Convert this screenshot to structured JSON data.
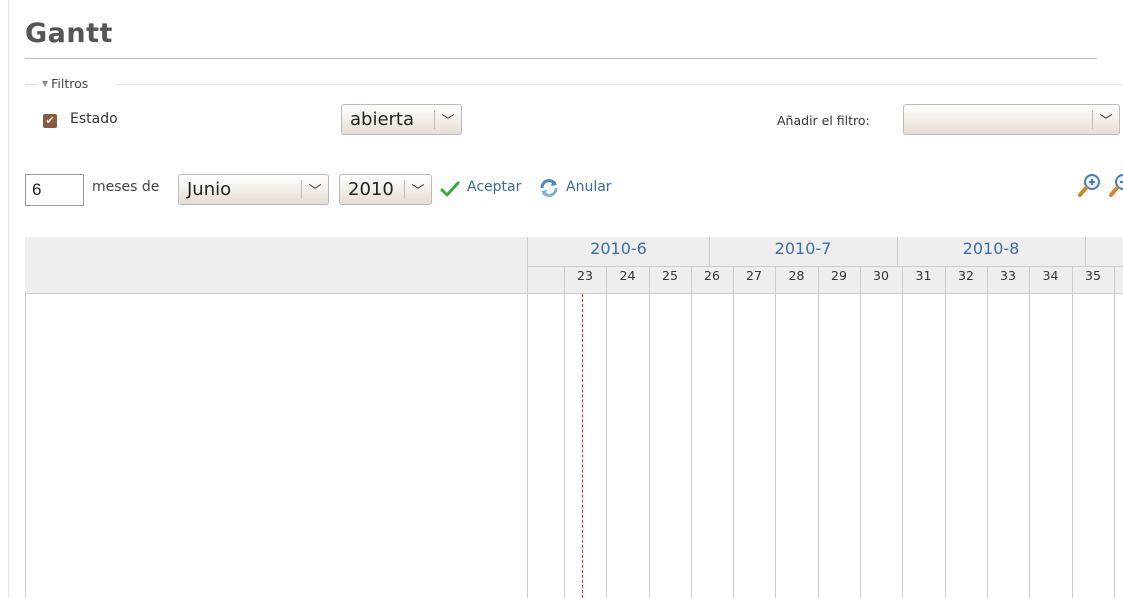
{
  "page": {
    "title": "Gantt"
  },
  "filters": {
    "legend": "Filtros",
    "estado_label": "Estado",
    "estado_checked": true,
    "estado_value": "abierta",
    "add_filter_label": "Añadir el filtro:",
    "add_filter_value": ""
  },
  "controls": {
    "months_count": "6",
    "months_of_label": "meses de",
    "month_value": "Junio",
    "year_value": "2010",
    "accept_label": "Aceptar",
    "cancel_label": "Anular"
  },
  "gantt": {
    "months": [
      "2010-6",
      "2010-7",
      "2010-8"
    ],
    "weeks": [
      "23",
      "24",
      "25",
      "26",
      "27",
      "28",
      "29",
      "30",
      "31",
      "32",
      "33",
      "34",
      "35"
    ]
  },
  "colors": {
    "link": "#3c6a9c",
    "month_header": "#3b6ea5",
    "today_line": "#dd3333",
    "checkbox": "#8a5a3e"
  }
}
